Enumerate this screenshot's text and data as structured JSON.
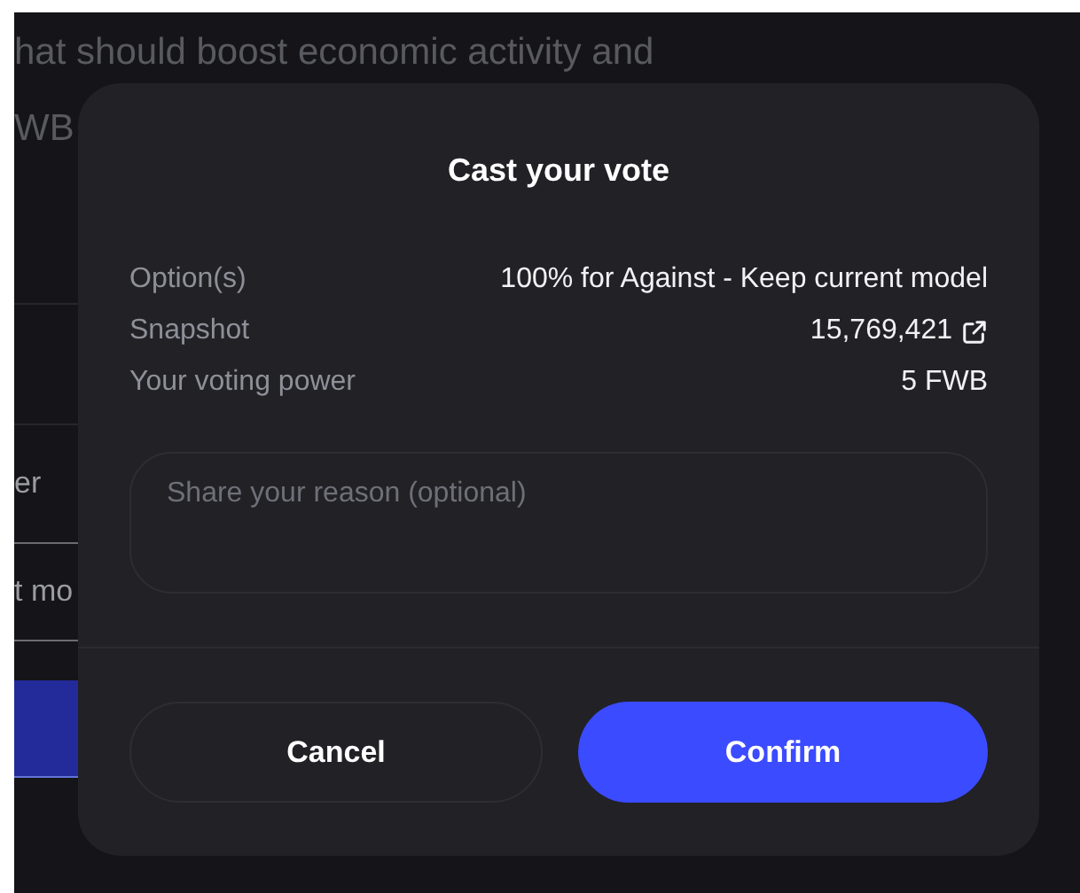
{
  "background": {
    "heading_lines": [
      "hat should boost economic activity and",
      "WB"
    ],
    "rows": [
      "er",
      "t mo"
    ]
  },
  "dialog": {
    "title": "Cast your vote",
    "details": [
      {
        "label": "Option(s)",
        "value": "100% for Against - Keep current model",
        "external_link": false
      },
      {
        "label": "Snapshot",
        "value": "15,769,421",
        "external_link": true
      },
      {
        "label": "Your voting power",
        "value": "5 FWB",
        "external_link": false
      }
    ],
    "reason": {
      "placeholder": "Share your reason (optional)"
    },
    "buttons": [
      {
        "label": "Cancel",
        "kind": "secondary"
      },
      {
        "label": "Confirm",
        "kind": "primary"
      }
    ]
  }
}
